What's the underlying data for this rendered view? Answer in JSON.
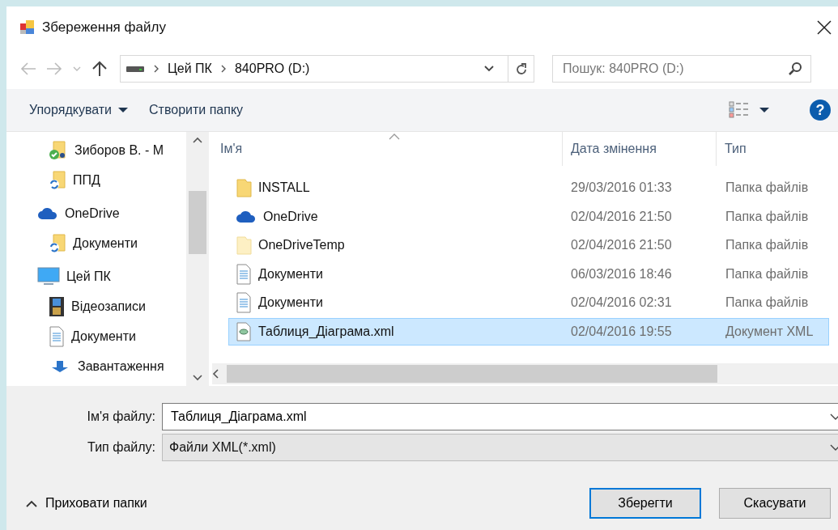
{
  "window": {
    "title": "Збереження файлу"
  },
  "address_bar": {
    "path": [
      "Цей ПК",
      "840PRO (D:)"
    ]
  },
  "search": {
    "placeholder": "Пошук: 840PRO (D:)"
  },
  "toolbar": {
    "organize": "Упорядкувати",
    "new_folder": "Створити папку",
    "help": "?"
  },
  "sidebar": {
    "items": [
      {
        "children": [
          {
            "label": "Зиборов В. - M",
            "kind": "shared-folder"
          },
          {
            "label": "ППД",
            "kind": "sync-folder"
          }
        ]
      },
      {
        "label": "OneDrive",
        "kind": "cloud",
        "children": [
          {
            "label": "Документи",
            "kind": "sync-folder"
          }
        ]
      },
      {
        "label": "Цей ПК",
        "kind": "monitor",
        "children": [
          {
            "label": "Відеозаписи",
            "kind": "film"
          },
          {
            "label": "Документи",
            "kind": "document"
          },
          {
            "label": "Завантаження",
            "kind": "download"
          }
        ]
      }
    ]
  },
  "table": {
    "columns": [
      "Ім'я",
      "Дата змінення",
      "Тип"
    ],
    "rows": [
      {
        "name": "INSTALL",
        "date": "29/03/2016 01:33",
        "type": "Папка файлів",
        "kind": "folder",
        "selected": false
      },
      {
        "name": "OneDrive",
        "date": "02/04/2016 21:50",
        "type": "Папка файлів",
        "kind": "cloud",
        "selected": false
      },
      {
        "name": "OneDriveTemp",
        "date": "02/04/2016 21:50",
        "type": "Папка файлів",
        "kind": "folder-pale",
        "selected": false
      },
      {
        "name": "Документи",
        "date": "06/03/2016 18:46",
        "type": "Папка файлів",
        "kind": "document",
        "selected": false
      },
      {
        "name": "Документи",
        "date": "02/04/2016 02:31",
        "type": "Папка файлів",
        "kind": "document",
        "selected": false
      },
      {
        "name": "Таблиця_Діаграма.xml",
        "date": "02/04/2016 19:55",
        "type": "Документ XML",
        "kind": "xml",
        "selected": true
      }
    ]
  },
  "form": {
    "file_name_label": "Ім'я файлу:",
    "file_name": "Таблиця_Діаграма.xml",
    "file_type_label": "Тип файлу:",
    "file_type": "Файли XML(*.xml)"
  },
  "footer": {
    "hide_folders": "Приховати папки",
    "buttons": [
      {
        "label": "Зберегти",
        "default": true
      },
      {
        "label": "Скасувати",
        "default": false
      }
    ]
  }
}
